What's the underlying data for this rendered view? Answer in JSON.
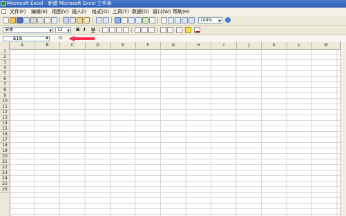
{
  "window": {
    "title": "Microsoft Excel - 新建 Microsoft Excel 工作表"
  },
  "menu": {
    "items": [
      {
        "label": "文件(F)"
      },
      {
        "label": "编辑(E)"
      },
      {
        "label": "视图(V)"
      },
      {
        "label": "插入(I)"
      },
      {
        "label": "格式(O)"
      },
      {
        "label": "工具(T)"
      },
      {
        "label": "数据(D)"
      },
      {
        "label": "窗口(W)"
      },
      {
        "label": "帮助(H)"
      }
    ]
  },
  "toolbar": {
    "zoom": "100%"
  },
  "format_toolbar": {
    "font": "宋体",
    "size": "12",
    "bold": "B",
    "italic": "I",
    "underline": "U"
  },
  "formula_bar": {
    "name_box": "E16",
    "fx": "fx"
  },
  "sheet": {
    "columns": [
      "A",
      "B",
      "C",
      "D",
      "E",
      "F",
      "G",
      "H",
      "I",
      "J",
      "K",
      "L",
      "M"
    ],
    "rows": [
      "1",
      "2",
      "3",
      "4",
      "5",
      "6",
      "7",
      "8",
      "9",
      "10",
      "11",
      "12",
      "13",
      "14",
      "15",
      "16",
      "17",
      "18",
      "19",
      "20",
      "21",
      "22",
      "23",
      "24",
      "25",
      "26"
    ]
  },
  "colors": {
    "annotation_arrow": "#ff2d55"
  }
}
